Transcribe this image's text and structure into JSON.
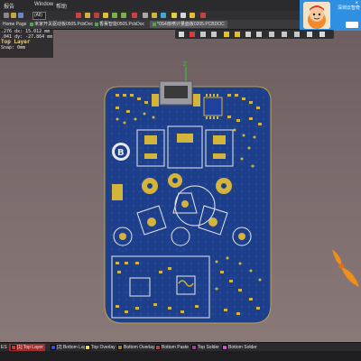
{
  "menubar": {
    "items": [
      "报告",
      "Window",
      "帮助"
    ],
    "combo": "(All)"
  },
  "doc_tabs": [
    {
      "label": "Home Page",
      "active": false
    },
    {
      "label": "米家开关驱动板0505.PcbDoc",
      "active": false
    },
    {
      "label": "香薰智能0505.PcbDoc",
      "active": false
    },
    {
      "label": "*0S4扇喷计量面板0205.PCBDOC",
      "active": true
    }
  ],
  "coords": {
    "x": ".276",
    "dx": "dx: 15.012",
    "y": ".041",
    "dy": "dy: -27.864",
    "unit_x": "mm",
    "unit_y": "mm",
    "layer": "Top Layer",
    "snap": "Snap: 0mm"
  },
  "notification": {
    "text": "深圳云智奇"
  },
  "pcb": {
    "board_color": "#1e3f8c",
    "pad_color": "#d4b43a",
    "silk_color": "#e8e8e8",
    "label": "B",
    "axis_label": "Z"
  },
  "layers": [
    {
      "label": "ES",
      "color": "#c03030",
      "active": false
    },
    {
      "label": "[1] Top Layer",
      "color": "#c83838",
      "active": true
    },
    {
      "label": "[2] Bottom Layer",
      "color": "#3050d8",
      "active": false
    },
    {
      "label": "Top Overlay",
      "color": "#f0e040",
      "active": false
    },
    {
      "label": "Bottom Overlay",
      "color": "#a08030",
      "active": false
    },
    {
      "label": "Bottom Paste",
      "color": "#c04040",
      "active": false
    },
    {
      "label": "Top Solder",
      "color": "#a040a0",
      "active": false
    },
    {
      "label": "Bottom Solder",
      "color": "#d050d0",
      "active": false
    }
  ]
}
